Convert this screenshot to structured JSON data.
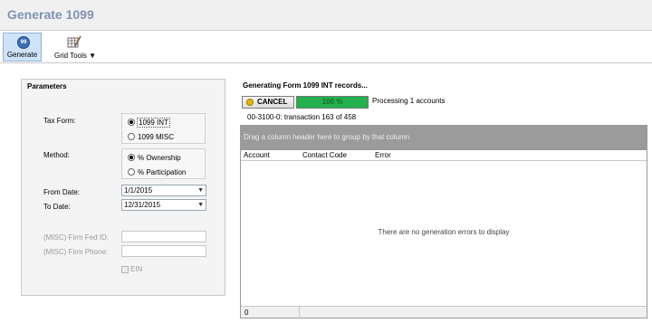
{
  "window": {
    "title": "Generate 1099"
  },
  "toolbar": {
    "generate_label": "Generate",
    "grid_tools_label": "Grid Tools ▼"
  },
  "parameters": {
    "title": "Parameters",
    "tax_form_label": "Tax Form:",
    "tax_form_options": [
      "1099 INT",
      "1099 MISC"
    ],
    "tax_form_selected": "1099 INT",
    "method_label": "Method:",
    "method_options": [
      "% Ownership",
      "% Participation"
    ],
    "method_selected": "% Ownership",
    "from_date_label": "From Date:",
    "from_date_value": "1/1/2015",
    "to_date_label": "To Date:",
    "to_date_value": "12/31/2015",
    "firm_fed_id_label": "(MISC) Firm Fed ID:",
    "firm_phone_label": "(MISC) Firm Phone:",
    "ein_label": "EIN"
  },
  "generation": {
    "title": "Generating Form 1099 INT records...",
    "cancel_label": "CANCEL",
    "progress_percent": 100,
    "progress_text": "100 %",
    "processing_text": "Processing 1 accounts",
    "transaction_text": "00-3100-0: transaction 163 of 458",
    "group_hint": "Drag a column header here to group by that column",
    "columns": [
      "Account",
      "Contact Code",
      "Error"
    ],
    "empty_message": "There are no generation errors to display",
    "footer_count": "0"
  },
  "colors": {
    "title": "#7f93b5",
    "progress_fill": "#22b14c",
    "group_bar": "#9b9b9b"
  }
}
